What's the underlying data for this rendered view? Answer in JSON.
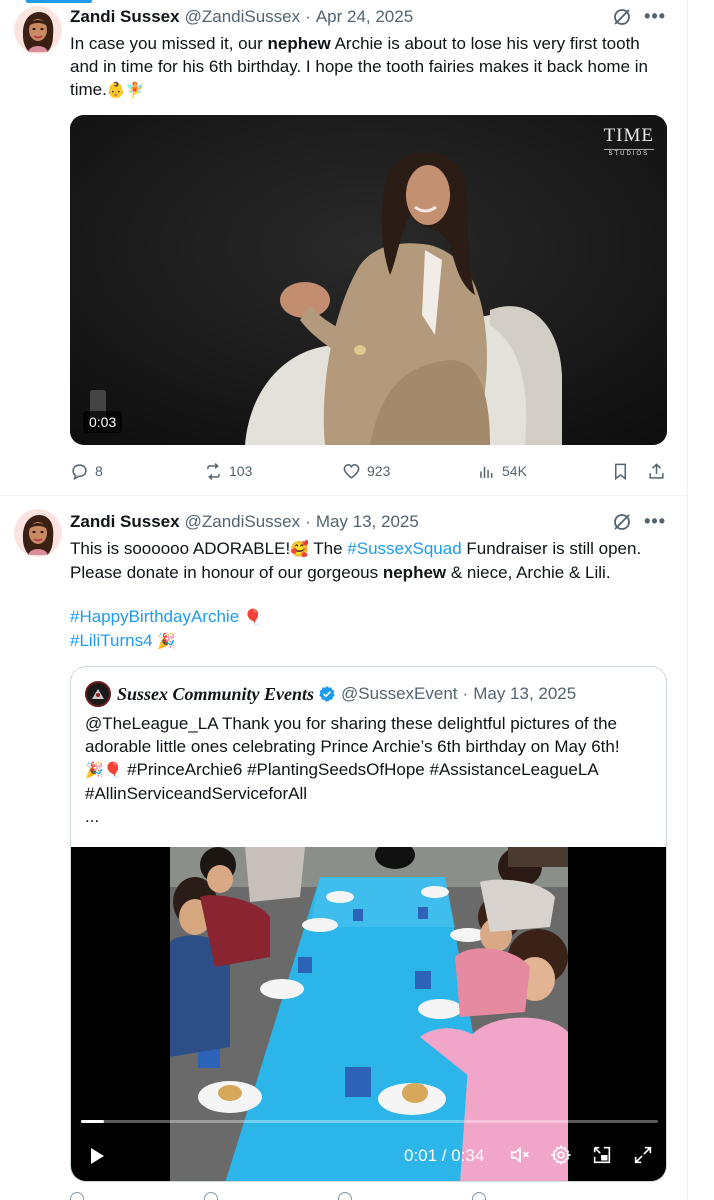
{
  "tweets": [
    {
      "name": "Zandi Sussex",
      "handle": "@ZandiSussex",
      "separator": "·",
      "date": "Apr 24, 2025",
      "text_parts": {
        "p1": "In case you missed it, our ",
        "b1": "nephew",
        "p2": " Archie is about to lose his very first tooth and in time for his 6th birthday. I hope the tooth fairies makes it back home in time.",
        "emoji": "👶🧚"
      },
      "video": {
        "time": "0:03",
        "watermark": "TIME",
        "watermark_sub": "STUDIOS"
      },
      "stats": {
        "replies": "8",
        "reposts": "103",
        "likes": "923",
        "views": "54K"
      }
    },
    {
      "name": "Zandi Sussex",
      "handle": "@ZandiSussex",
      "separator": "·",
      "date": "May 13, 2025",
      "text_parts": {
        "p1": "This is soooooo ADORABLE!",
        "emoji1": "🥰",
        "p2": " The ",
        "link1": "#SussexSquad",
        "p3": " Fundraiser is still open. Please donate in honour of our gorgeous ",
        "b1": "nephew",
        "p4": " & niece, Archie & Lili.",
        "tag1": "#HappyBirthdayArchie",
        "emoji2": "🎈",
        "tag2": "#LiliTurns4",
        "emoji3": "🎉"
      },
      "quote": {
        "name": "Sussex Community Events",
        "handle": "@SussexEvent",
        "separator": "·",
        "date": "May 13, 2025",
        "text": "@TheLeague_LA Thank you for sharing these delightful pictures of the adorable little ones celebrating Prince Archie’s 6th birthday on May 6th!",
        "emoji_line": "🎉🎈",
        "tags_line": " #PrinceArchie6 #PlantingSeedsOfHope #AssistanceLeagueLA",
        "tags_line2": "#AllinServiceandServiceforAll",
        "ellipsis": "...",
        "video": {
          "time": "0:01 / 0:34",
          "progress": 0.04
        }
      }
    }
  ],
  "colors": {
    "accent": "#1d9bf0",
    "text": "#0f1419",
    "muted": "#536471",
    "border": "#cfd9de",
    "table_blue": "#2bb5e8"
  },
  "icons": [
    "grok-icon",
    "more-icon",
    "reply-icon",
    "repost-icon",
    "like-icon",
    "views-icon",
    "bookmark-icon",
    "share-icon",
    "verified-icon",
    "play-icon",
    "mute-icon",
    "settings-icon",
    "pip-icon",
    "fullscreen-icon"
  ]
}
